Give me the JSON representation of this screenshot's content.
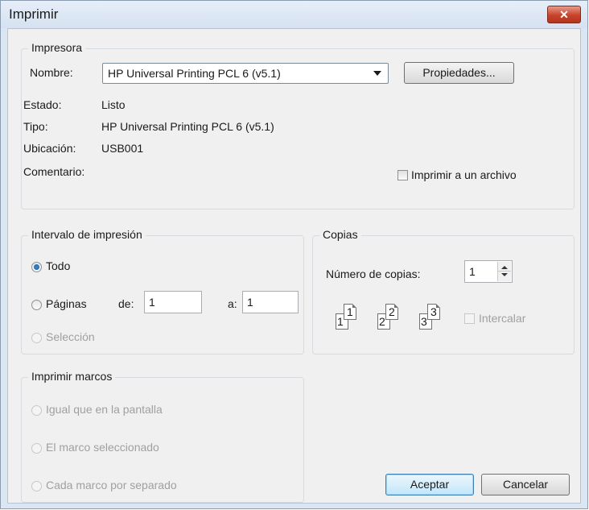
{
  "window": {
    "title": "Imprimir",
    "close_label": "✕"
  },
  "printer": {
    "legend": "Impresora",
    "name_label": "Nombre:",
    "name_value": "HP Universal Printing PCL 6 (v5.1)",
    "properties_label": "Propiedades...",
    "status_label": "Estado:",
    "status_value": "Listo",
    "type_label": "Tipo:",
    "type_value": "HP Universal Printing PCL 6 (v5.1)",
    "location_label": "Ubicación:",
    "location_value": "USB001",
    "comment_label": "Comentario:",
    "print_to_file_label": "Imprimir a un archivo"
  },
  "range": {
    "legend": "Intervalo de impresión",
    "all_label": "Todo",
    "pages_label": "Páginas",
    "from_label": "de:",
    "from_value": "1",
    "to_label": "a:",
    "to_value": "1",
    "selection_label": "Selección"
  },
  "copies": {
    "legend": "Copias",
    "count_label": "Número de copias:",
    "count_value": "1",
    "collate_label": "Intercalar",
    "pages": [
      "1",
      "1",
      "2",
      "2",
      "3",
      "3"
    ]
  },
  "frames": {
    "legend": "Imprimir marcos",
    "as_screen_label": "Igual que en la pantalla",
    "selected_label": "El marco seleccionado",
    "separately_label": "Cada marco por separado"
  },
  "buttons": {
    "ok_label": "Aceptar",
    "cancel_label": "Cancelar"
  }
}
